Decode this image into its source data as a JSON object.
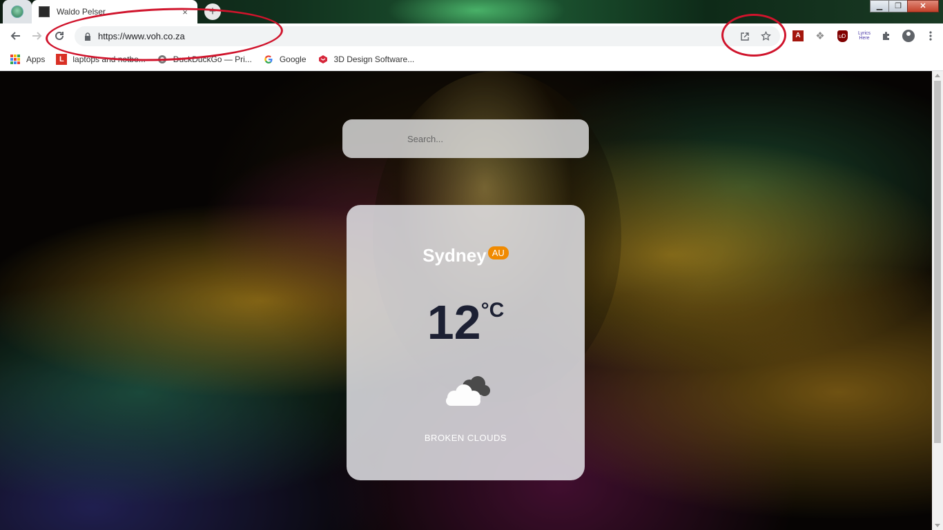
{
  "browser": {
    "active_tab": {
      "title": "Waldo Pelser",
      "close_label": "×"
    },
    "new_tab_label": "+",
    "window_controls": {
      "minimize": "▁",
      "restore": "❐",
      "close": "✕"
    },
    "url": "https://www.voh.co.za",
    "bookmarks": [
      {
        "label": "Apps",
        "icon": "apps-grid-icon"
      },
      {
        "label": "laptops and notbo...",
        "icon": "L-icon",
        "color": "#d93025"
      },
      {
        "label": "DuckDuckGo — Pri...",
        "icon": "globe-icon"
      },
      {
        "label": "Google",
        "icon": "google-icon"
      },
      {
        "label": "3D Design Software...",
        "icon": "sketchup-icon",
        "color": "#d6263a"
      }
    ],
    "extensions": {
      "pdf": "A",
      "ublock": "uD",
      "lyrics": "Lyrics Here"
    }
  },
  "page": {
    "search_placeholder": "Search...",
    "weather": {
      "city": "Sydney",
      "country": "AU",
      "temperature": "12",
      "unit": "°C",
      "description": "BROKEN CLOUDS",
      "icon": "broken-clouds-icon"
    }
  },
  "colors": {
    "annotation": "#d0142c",
    "badge": "#f08a00",
    "temperature_text": "#1c2033"
  }
}
